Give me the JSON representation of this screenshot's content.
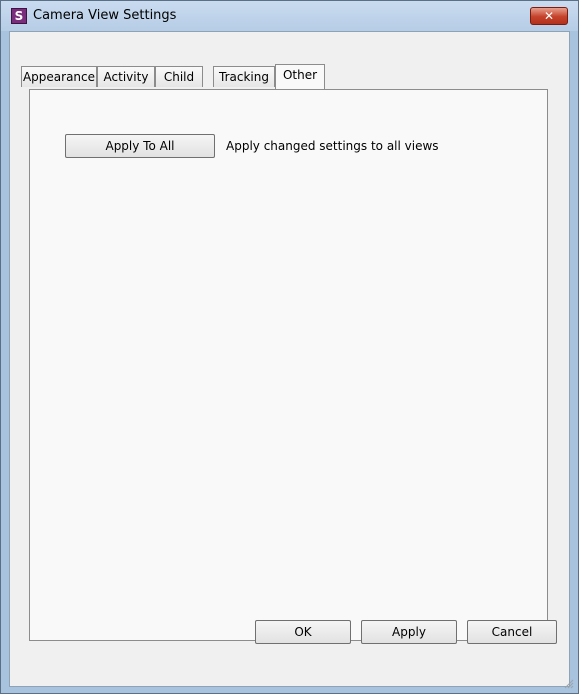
{
  "window": {
    "title": "Camera View Settings",
    "app_icon_letter": "S",
    "close_glyph": "✕"
  },
  "tabs": [
    {
      "label": "Appearance",
      "active": false
    },
    {
      "label": "Activity",
      "active": false
    },
    {
      "label": "Child",
      "active": false
    },
    {
      "label": "Tracking",
      "active": false
    },
    {
      "label": "Other",
      "active": true
    }
  ],
  "other_tab": {
    "apply_all_label": "Apply To All",
    "apply_all_description": "Apply changed settings to all views"
  },
  "footer": {
    "ok_label": "OK",
    "apply_label": "Apply",
    "cancel_label": "Cancel"
  }
}
